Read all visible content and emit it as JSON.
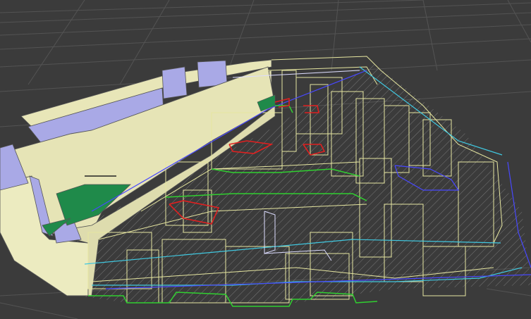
{
  "viewport": {
    "name": "3d-building-model-viewport",
    "background_color": "#3b3b3b",
    "grid_color": "#5a5a5a"
  },
  "colors": {
    "solid_wall": "#e8e6b8",
    "solid_wall_shade": "#c9c79a",
    "facade_blue": "#a9a9e6",
    "floor_green": "#1f8a4a",
    "wire_yellow": "#e6e6a0",
    "wire_blue": "#4848ff",
    "wire_cyan": "#40c8e0",
    "wire_green": "#30d030",
    "wire_red": "#e02020",
    "wire_white": "#dcdcff",
    "hatch": "#a8a8a8"
  }
}
